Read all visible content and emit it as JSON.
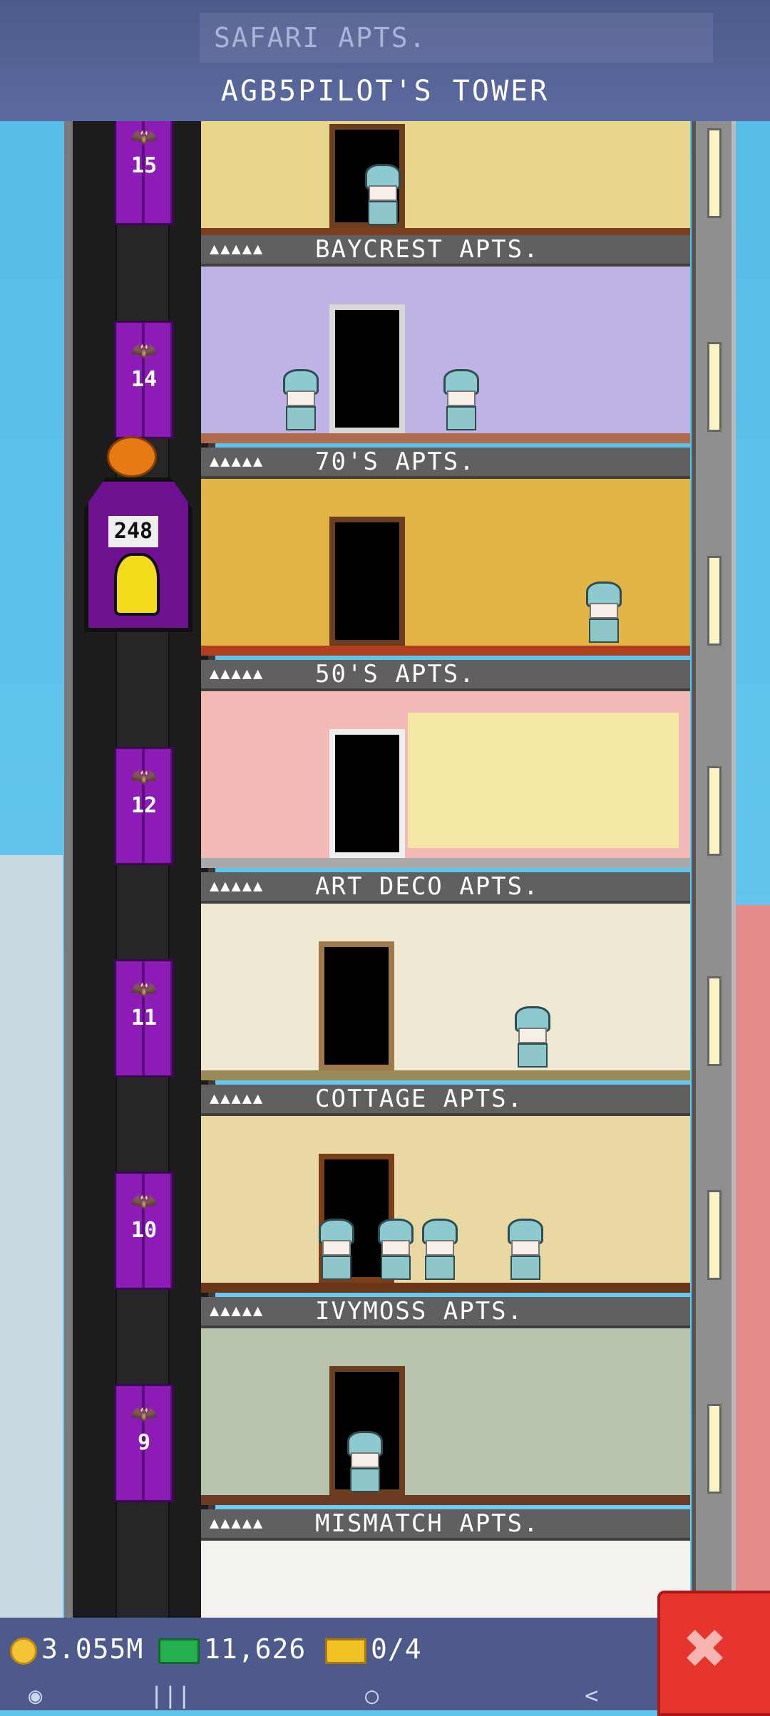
{
  "header": {
    "partial_floor_label": "SAFARI APTS.",
    "tower_title": "AGB5PILOT'S TOWER"
  },
  "elevator": {
    "floor_numbers": [
      "15",
      "14",
      "12",
      "11",
      "10",
      "9"
    ],
    "car_display": "248"
  },
  "floors": [
    {
      "name": "BAYCREST APTS.",
      "stars": "▲▲▲▲▲"
    },
    {
      "name": "70'S APTS.",
      "stars": "▲▲▲▲▲"
    },
    {
      "name": "50'S APTS.",
      "stars": "▲▲▲▲▲"
    },
    {
      "name": "ART DECO APTS.",
      "stars": "▲▲▲▲▲"
    },
    {
      "name": "COTTAGE APTS.",
      "stars": "▲▲▲▲▲"
    },
    {
      "name": "IVYMOSS APTS.",
      "stars": "▲▲▲▲▲"
    },
    {
      "name": "MISMATCH APTS.",
      "stars": "▲▲▲▲▲"
    }
  ],
  "resources": {
    "coins": "3.055M",
    "bux": "11,626",
    "tickets": "0/4"
  },
  "nav": {
    "back": "<",
    "home": "○",
    "recents": "|||"
  },
  "colors": {
    "header_bg": "#4d5a8b",
    "elevator_door": "#8d1cb7",
    "close_button": "#e6352f"
  }
}
